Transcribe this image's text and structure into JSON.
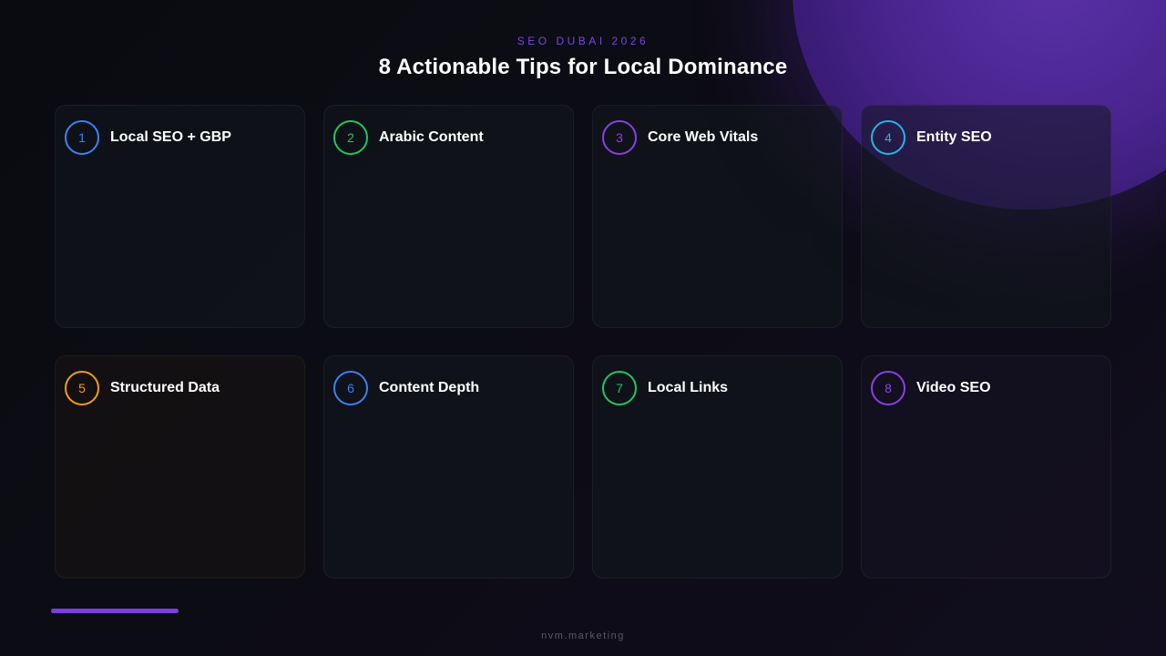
{
  "header": {
    "eyebrow": "SEO DUBAI 2026",
    "title": "8 Actionable Tips for Local Dominance"
  },
  "tips": [
    {
      "number": "1",
      "label": "Local SEO + GBP",
      "accent": "#3b82f6"
    },
    {
      "number": "2",
      "label": "Arabic Content",
      "accent": "#22c55e"
    },
    {
      "number": "3",
      "label": "Core Web Vitals",
      "accent": "#8b3fe6"
    },
    {
      "number": "4",
      "label": "Entity SEO",
      "accent": "#22b5e6"
    },
    {
      "number": "5",
      "label": "Structured Data",
      "accent": "#f59e0b"
    },
    {
      "number": "6",
      "label": "Content Depth",
      "accent": "#3b82f6"
    },
    {
      "number": "7",
      "label": "Local Links",
      "accent": "#22c55e"
    },
    {
      "number": "8",
      "label": "Video SEO",
      "accent": "#8b3fe6"
    }
  ],
  "progress": {
    "fraction": 0.125,
    "color": "#7b3fe4"
  },
  "footer": {
    "brand": "nvm.marketing"
  },
  "colors": {
    "background": "#0b0a12",
    "accent_purple": "#7b45e6",
    "glow": "#4a2590"
  }
}
